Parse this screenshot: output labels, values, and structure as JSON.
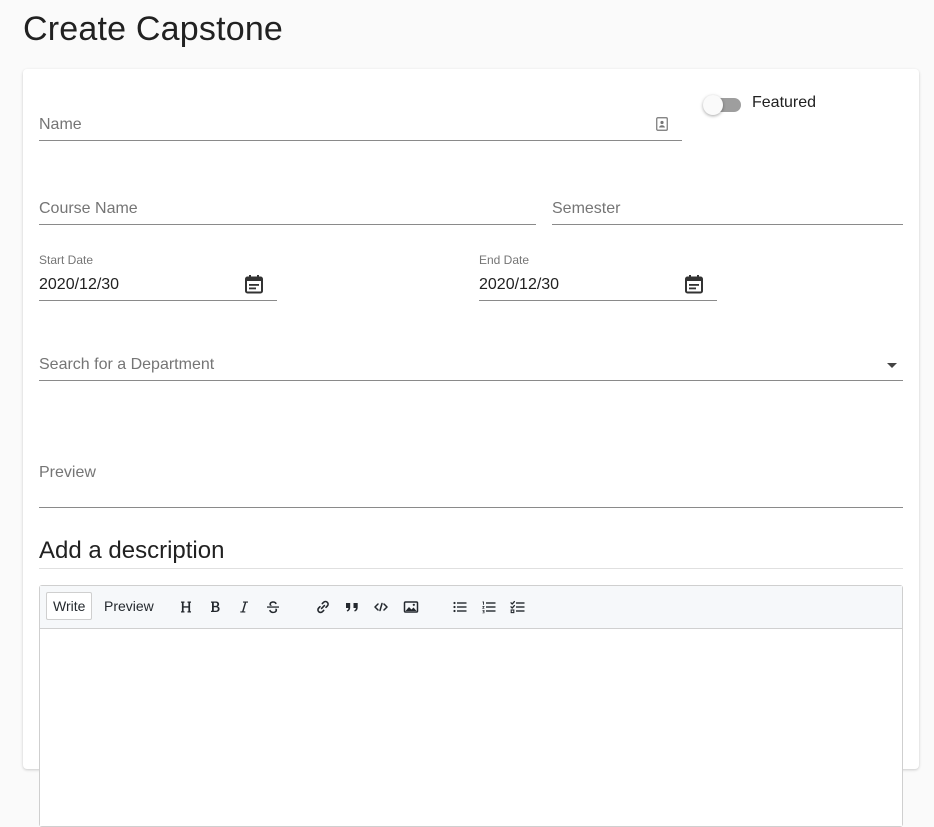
{
  "page": {
    "title": "Create Capstone"
  },
  "form": {
    "name": {
      "placeholder": "Name"
    },
    "featured": {
      "label": "Featured",
      "checked": false
    },
    "course_name": {
      "placeholder": "Course Name"
    },
    "semester": {
      "placeholder": "Semester"
    },
    "start_date": {
      "label": "Start Date",
      "value": "2020/12/30"
    },
    "end_date": {
      "label": "End Date",
      "value": "2020/12/30"
    },
    "department": {
      "placeholder": "Search for a Department"
    },
    "preview": {
      "placeholder": "Preview"
    }
  },
  "description": {
    "title": "Add a description",
    "tabs": [
      {
        "label": "Write",
        "active": true
      },
      {
        "label": "Preview",
        "active": false
      }
    ],
    "tools": [
      "heading-icon",
      "bold-icon",
      "italic-icon",
      "strikethrough-icon",
      "link-icon",
      "quote-icon",
      "code-icon",
      "image-icon",
      "bullet-list-icon",
      "numbered-list-icon",
      "task-list-icon"
    ]
  },
  "colors": {
    "background": "#fafafa",
    "card": "#ffffff",
    "text": "#212121",
    "muted": "#757575"
  }
}
